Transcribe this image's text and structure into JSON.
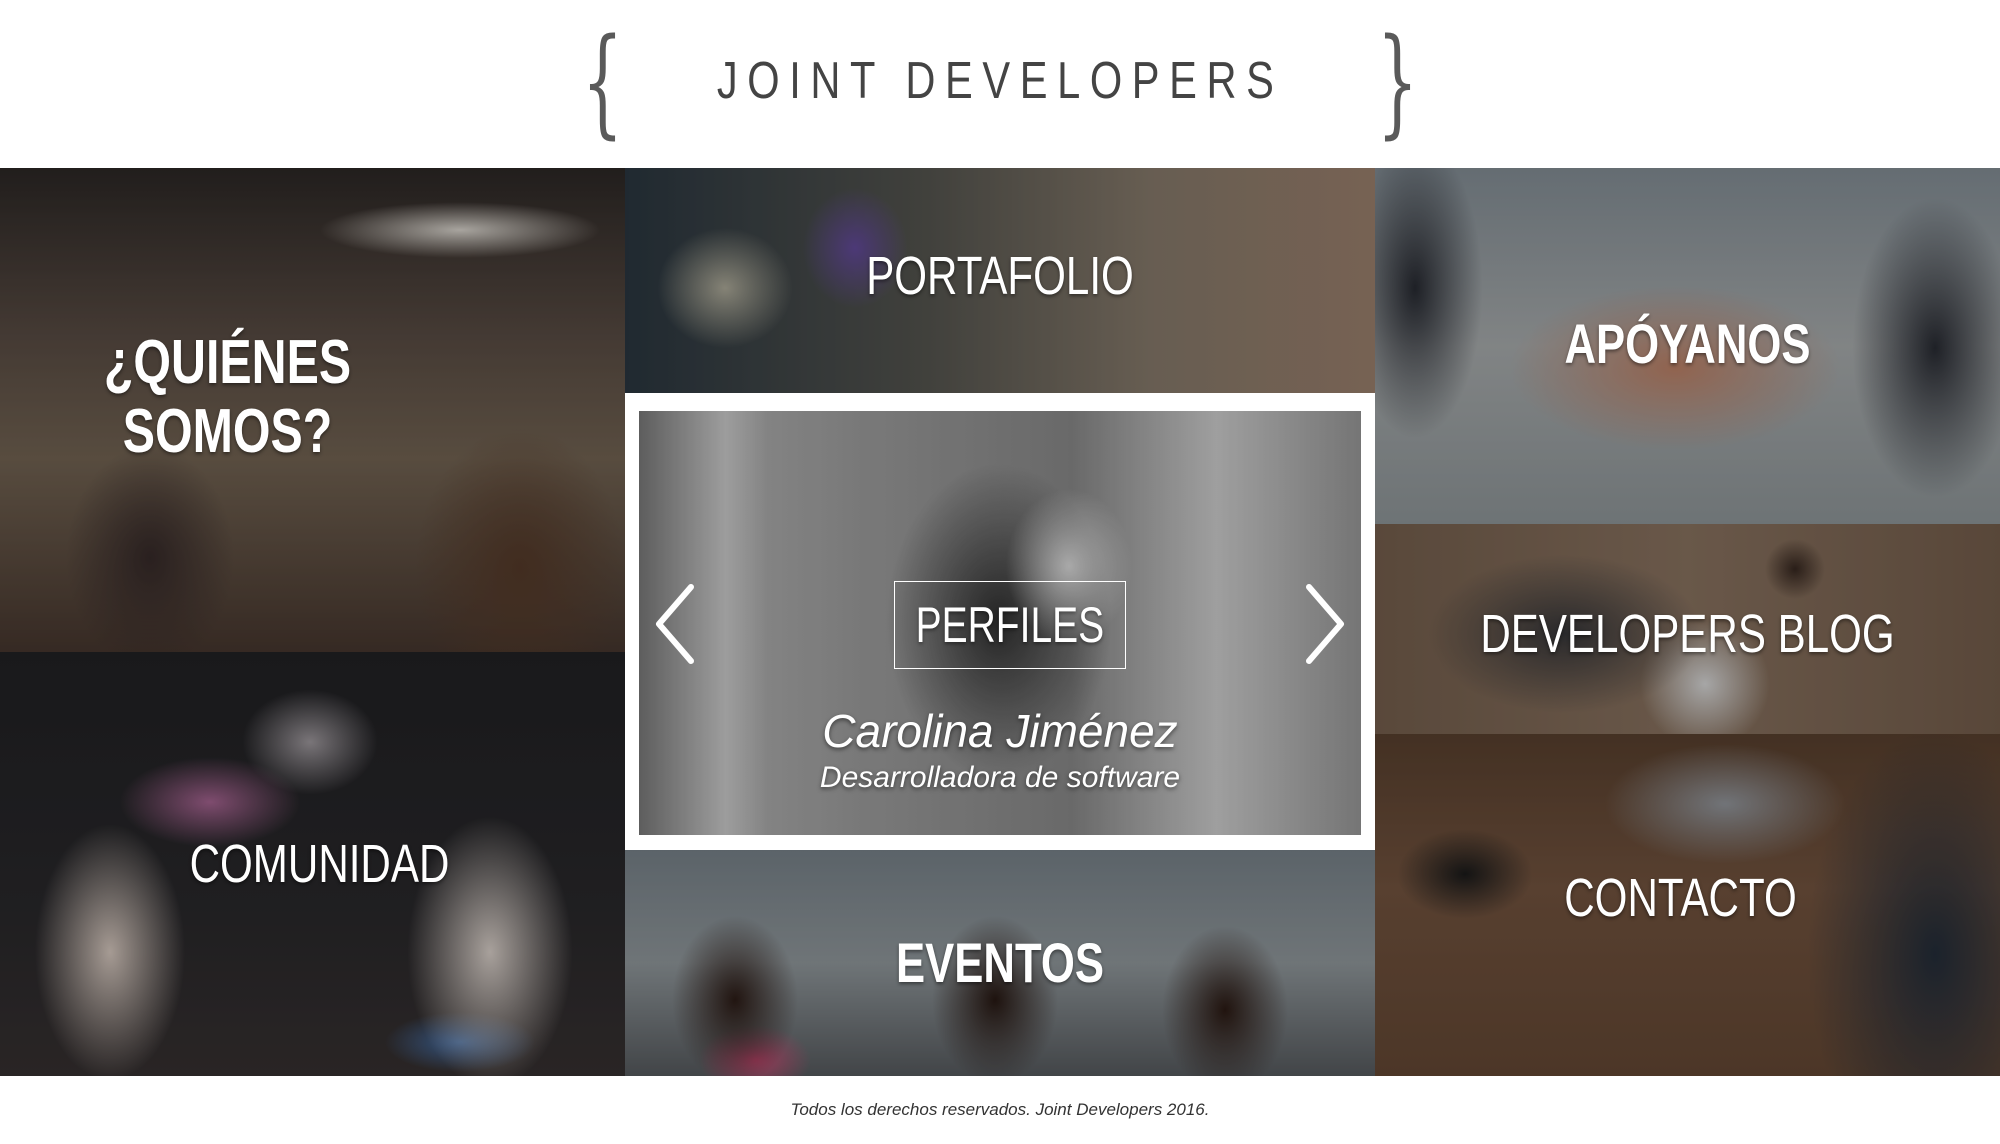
{
  "header": {
    "logo_text": "JOINT DEVELOPERS",
    "brace_left": "{",
    "brace_right": "}"
  },
  "tiles": {
    "quienes": "¿QUIÉNES SOMOS?",
    "portafolio": "PORTAFOLIO",
    "apoyanos": "APÓYANOS",
    "blog": "DEVELOPERS BLOG",
    "comunidad": "COMUNIDAD",
    "eventos": "EVENTOS",
    "contacto": "CONTACTO"
  },
  "perfiles": {
    "title": "PERFILES",
    "name": "Carolina Jiménez",
    "role": "Desarrolladora de software",
    "prev_icon": "chevron-left-icon",
    "next_icon": "chevron-right-icon"
  },
  "footer": {
    "text": "Todos los derechos reservados. Joint Developers 2016."
  }
}
